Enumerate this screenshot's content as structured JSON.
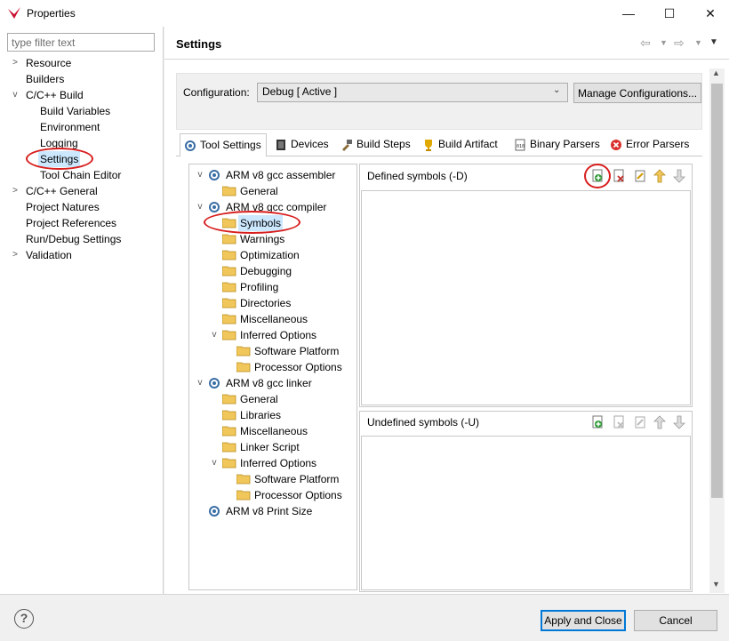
{
  "window": {
    "title": "Properties",
    "minimize": "—",
    "maximize": "☐",
    "close": "✕"
  },
  "filter": {
    "placeholder": "type filter text"
  },
  "nav": {
    "resource": "Resource",
    "builders": "Builders",
    "cc_build": "C/C++ Build",
    "build_variables": "Build Variables",
    "environment": "Environment",
    "logging": "Logging",
    "settings": "Settings",
    "tool_chain_editor": "Tool Chain Editor",
    "cc_general": "C/C++ General",
    "project_natures": "Project Natures",
    "project_references": "Project References",
    "run_debug_settings": "Run/Debug Settings",
    "validation": "Validation"
  },
  "page": {
    "title": "Settings"
  },
  "config": {
    "label": "Configuration:",
    "value": "Debug  [ Active ]",
    "manage": "Manage Configurations..."
  },
  "tabs": {
    "tool_settings": "Tool Settings",
    "devices": "Devices",
    "build_steps": "Build Steps",
    "build_artifact": "Build Artifact",
    "binary_parsers": "Binary Parsers",
    "error_parsers": "Error Parsers"
  },
  "tree": {
    "assembler": "ARM v8 gcc assembler",
    "asm_general": "General",
    "compiler": "ARM v8 gcc compiler",
    "symbols": "Symbols",
    "warnings": "Warnings",
    "optimization": "Optimization",
    "debugging": "Debugging",
    "profiling": "Profiling",
    "directories": "Directories",
    "misc": "Miscellaneous",
    "inferred": "Inferred Options",
    "sw_platform": "Software Platform",
    "proc_options": "Processor Options",
    "linker": "ARM v8 gcc linker",
    "ld_general": "General",
    "libraries": "Libraries",
    "ld_misc": "Miscellaneous",
    "linker_script": "Linker Script",
    "ld_inferred": "Inferred Options",
    "ld_sw_platform": "Software Platform",
    "ld_proc_options": "Processor Options",
    "print_size": "ARM v8 Print Size"
  },
  "defined": {
    "title": "Defined symbols (-D)"
  },
  "undefined": {
    "title": "Undefined symbols (-U)"
  },
  "buttons": {
    "apply_close": "Apply and Close",
    "cancel": "Cancel"
  },
  "colors": {
    "highlight_circle": "#d81e1e",
    "selected_bg": "#cce8ff",
    "accent": "#0078d7"
  }
}
